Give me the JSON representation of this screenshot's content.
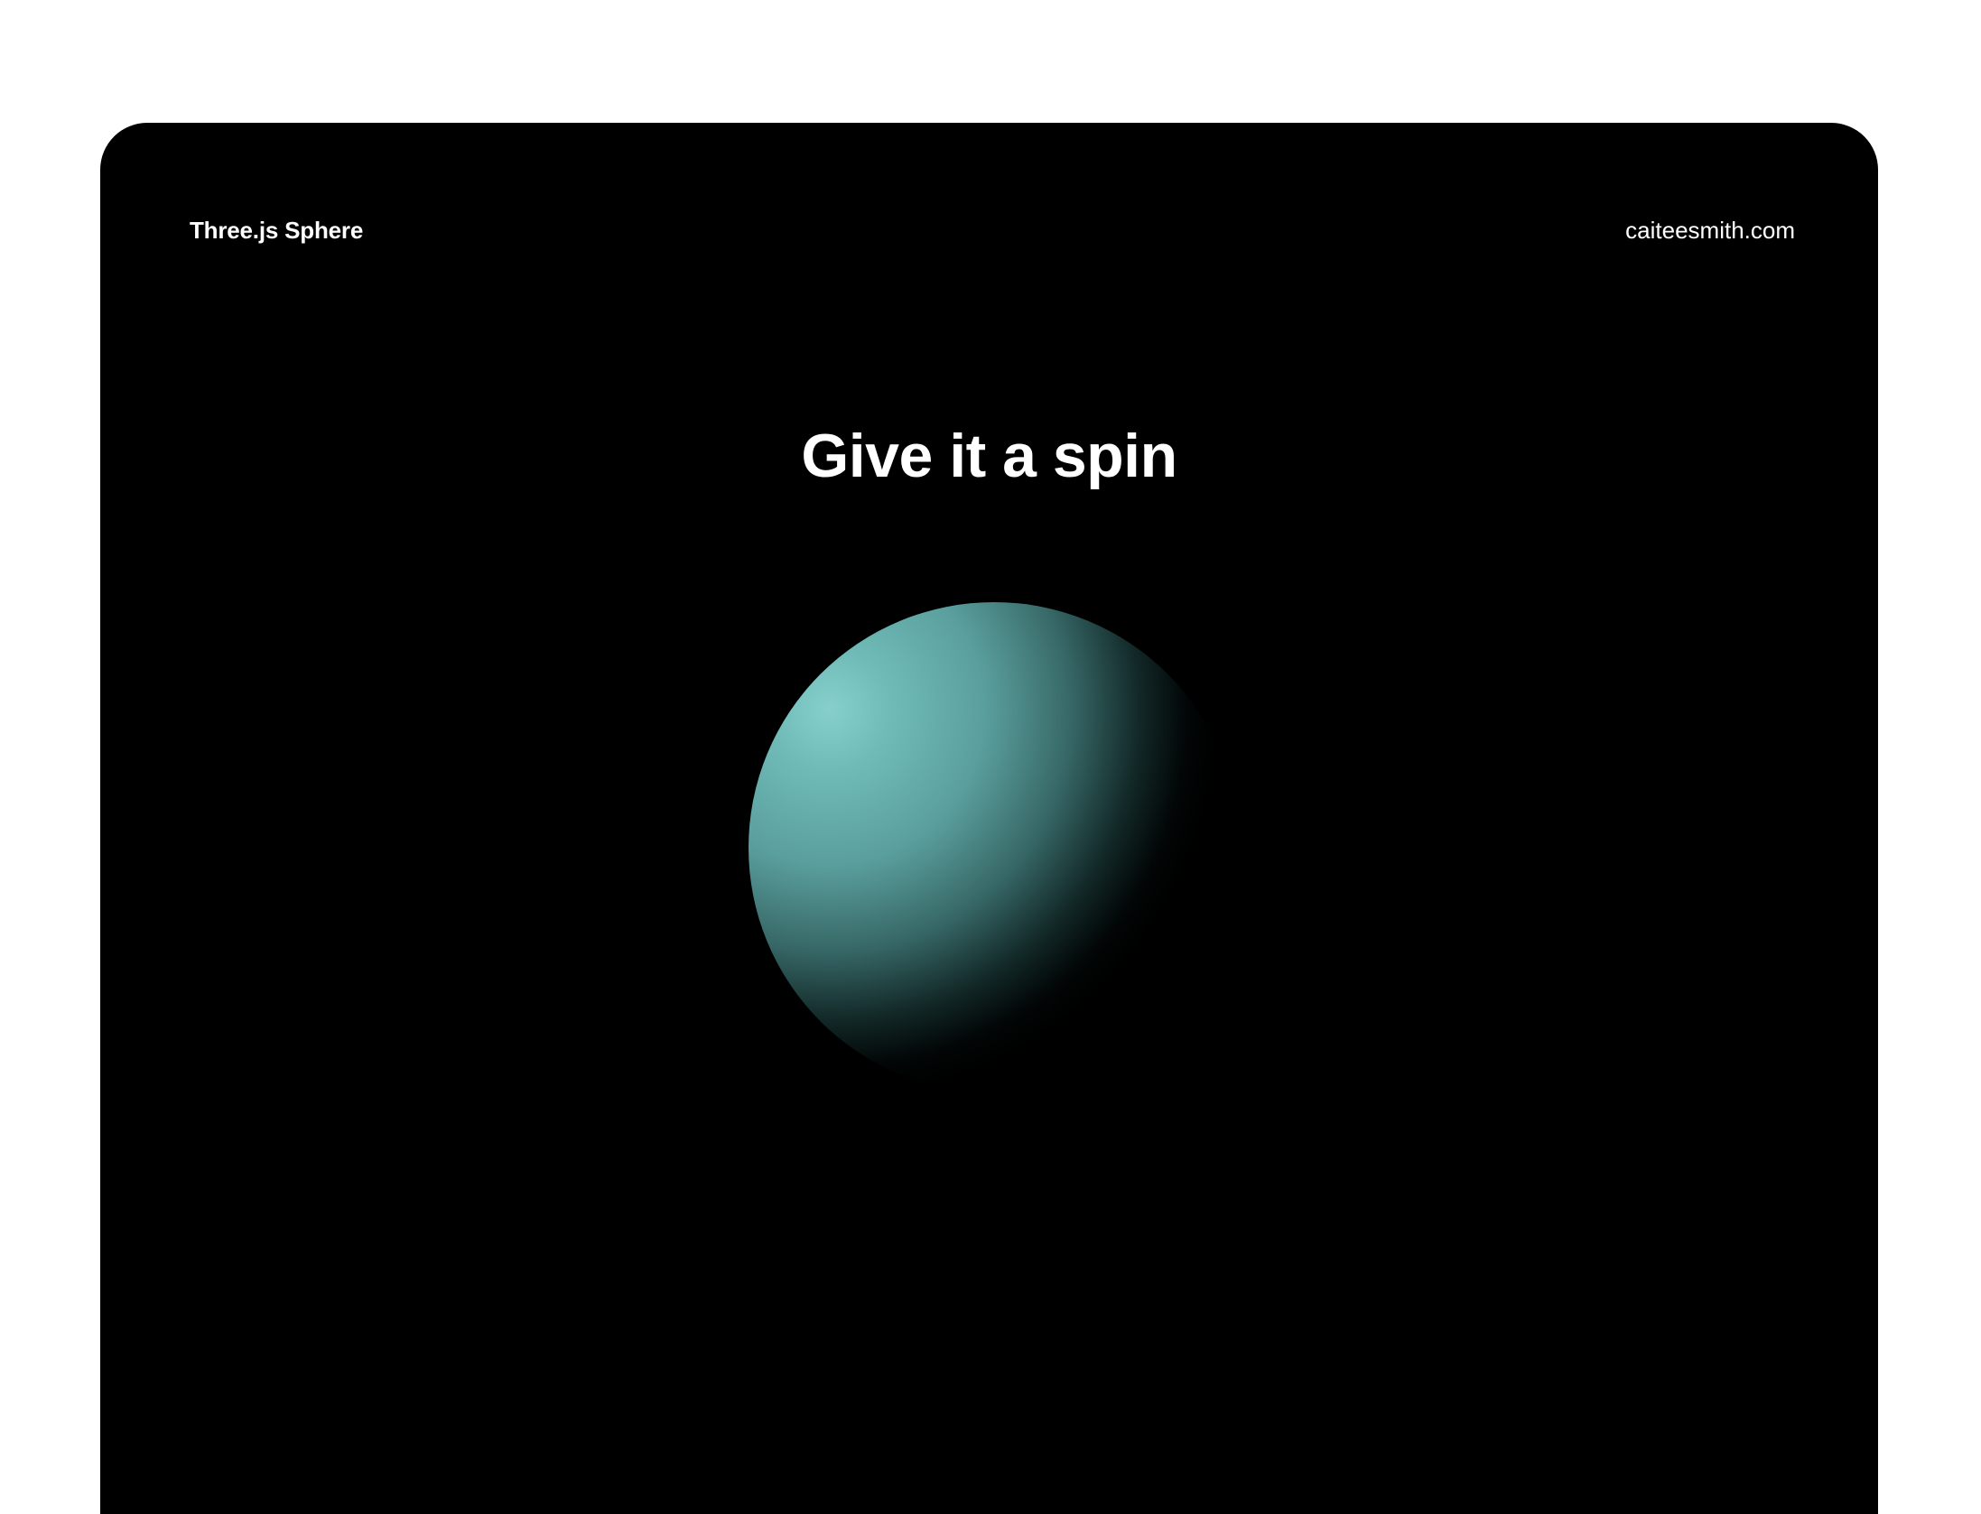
{
  "header": {
    "logo": "Three.js Sphere",
    "link": "caiteesmith.com"
  },
  "main": {
    "headline": "Give it a spin"
  },
  "colors": {
    "background": "#000000",
    "page": "#ffffff",
    "sphere": "#67b7b5",
    "text": "#ffffff"
  }
}
